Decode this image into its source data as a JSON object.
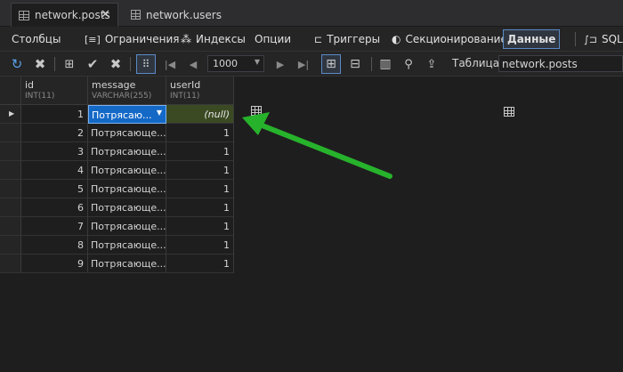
{
  "tabs": [
    {
      "label": "network.posts",
      "active": true
    },
    {
      "label": "network.users",
      "active": false
    }
  ],
  "sections": [
    "Столбцы",
    "Ограничения",
    "Индексы",
    "Опции",
    "Триггеры",
    "Секционирование",
    "Данные",
    "SQL"
  ],
  "active_section": "Данные",
  "toolbar": {
    "page_size": "1000",
    "table_label": "Таблица",
    "table_value": "network.posts"
  },
  "columns": [
    {
      "name": "id",
      "type": "INT(11)"
    },
    {
      "name": "message",
      "type": "VARCHAR(255)"
    },
    {
      "name": "userId",
      "type": "INT(11)"
    }
  ],
  "rows": [
    {
      "id": "1",
      "message": "Потрясаю...",
      "userId": "(null)"
    },
    {
      "id": "2",
      "message": "Потрясающе...",
      "userId": "1"
    },
    {
      "id": "3",
      "message": "Потрясающе...",
      "userId": "1"
    },
    {
      "id": "4",
      "message": "Потрясающе...",
      "userId": "1"
    },
    {
      "id": "5",
      "message": "Потрясающе...",
      "userId": "1"
    },
    {
      "id": "6",
      "message": "Потрясающе...",
      "userId": "1"
    },
    {
      "id": "7",
      "message": "Потрясающе...",
      "userId": "1"
    },
    {
      "id": "8",
      "message": "Потрясающе...",
      "userId": "1"
    },
    {
      "id": "9",
      "message": "Потрясающе...",
      "userId": "1"
    }
  ],
  "colors": {
    "active_cell": "#1469c7",
    "null_cell": "#3b4a23",
    "arrow": "#27b22c"
  }
}
